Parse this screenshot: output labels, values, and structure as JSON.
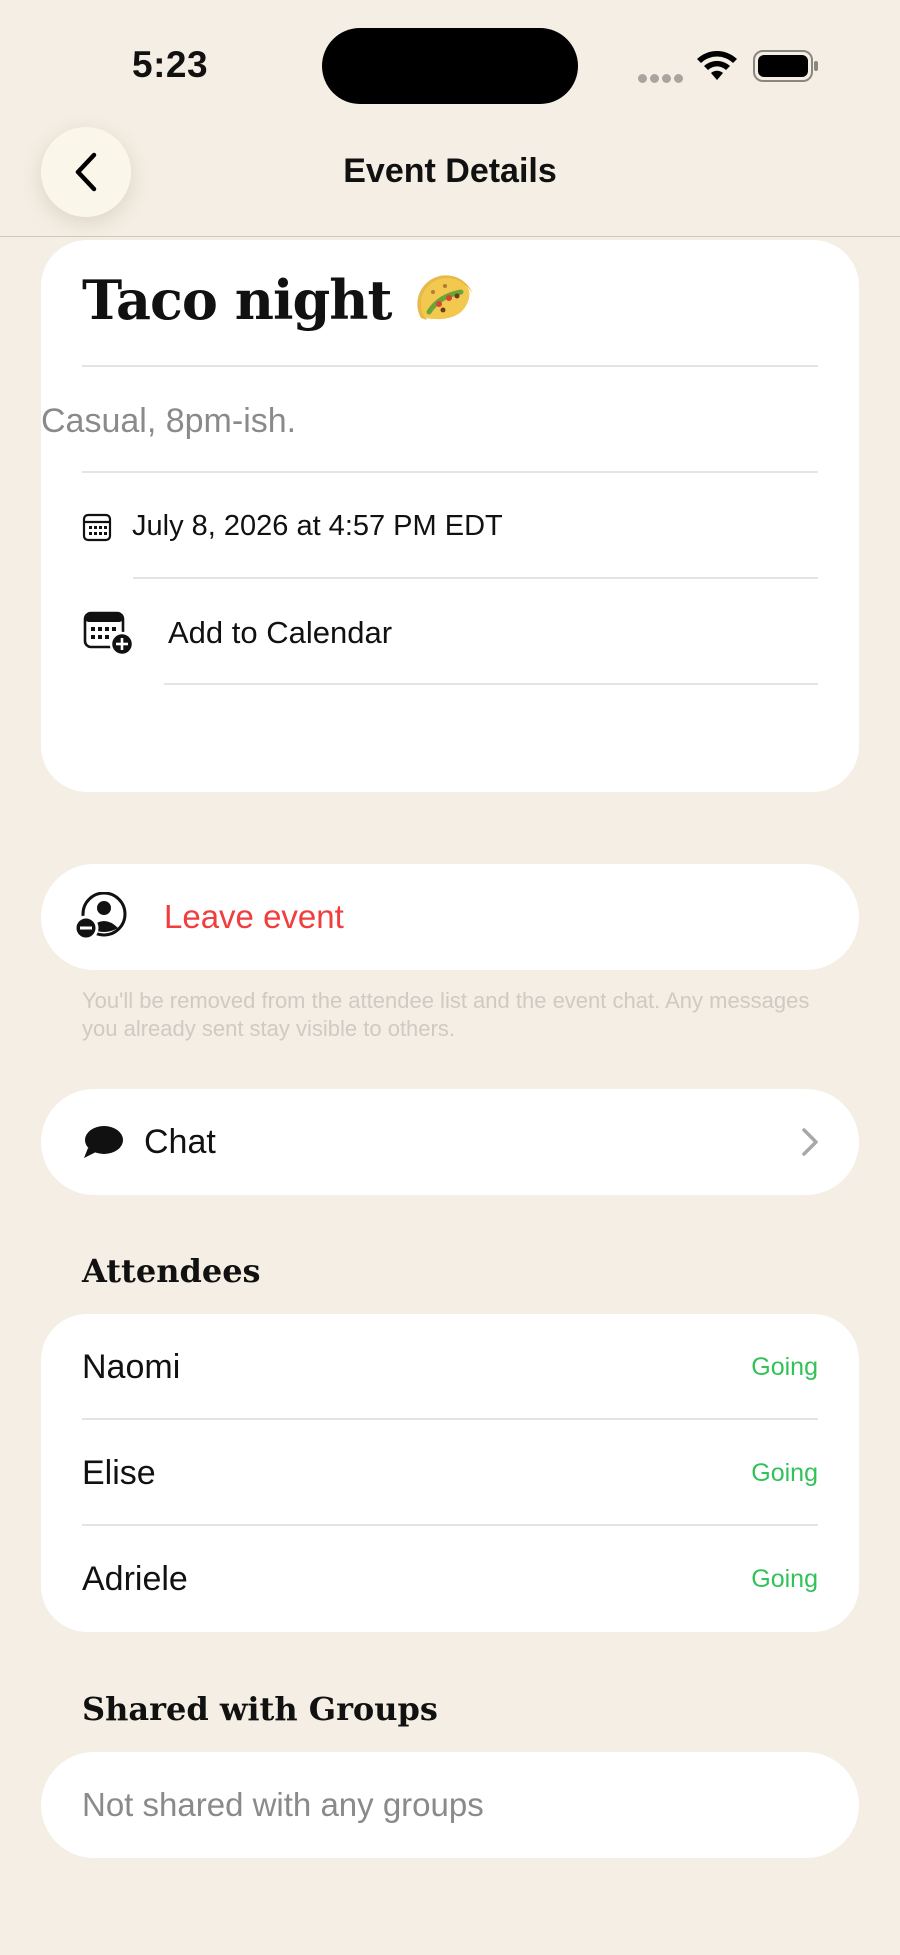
{
  "status_bar": {
    "time": "5:23"
  },
  "nav": {
    "title": "Event Details",
    "back_icon": "chevron-left-icon"
  },
  "event": {
    "title": "Taco night",
    "emoji_icon": "taco-icon",
    "description": "Casual, 8pm-ish.",
    "date": "July 8, 2026 at 4:57 PM EDT",
    "add_to_calendar_label": "Add to Calendar"
  },
  "leave": {
    "label": "Leave event",
    "note": "You'll be removed from the attendee list and the event chat. Any messages you already sent stay visible to others.",
    "color": "#F13D3D"
  },
  "chat": {
    "label": "Chat"
  },
  "attendees": {
    "title": "Attendees",
    "status_color": "#33C15A",
    "items": [
      {
        "name": "Naomi",
        "status": "Going"
      },
      {
        "name": "Elise",
        "status": "Going"
      },
      {
        "name": "Adriele",
        "status": "Going"
      }
    ]
  },
  "groups": {
    "title": "Shared with Groups",
    "empty_text": "Not shared with any groups"
  },
  "colors": {
    "background": "#F4EEE4",
    "card": "#FFFFFF"
  }
}
